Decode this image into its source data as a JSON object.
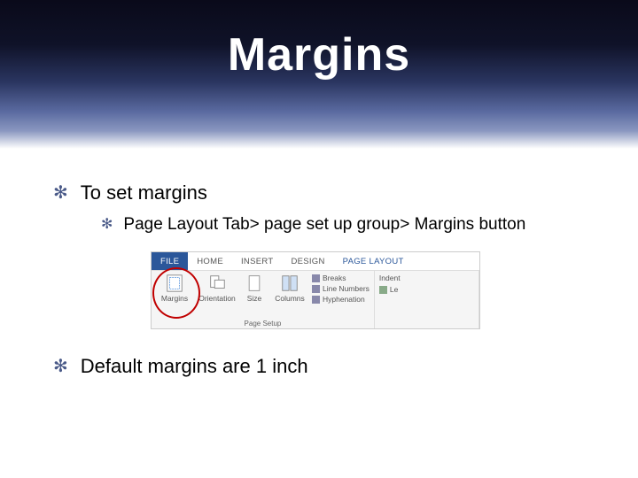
{
  "title": "Margins",
  "bullets": {
    "b1": "To set margins",
    "b1_1": "Page Layout Tab> page set up group> Margins button",
    "b2": "Default margins are 1 inch"
  },
  "ribbon": {
    "tabs": {
      "file": "FILE",
      "home": "HOME",
      "insert": "INSERT",
      "design": "DESIGN",
      "page_layout": "PAGE LAYOUT"
    },
    "page_setup": {
      "margins": "Margins",
      "orientation": "Orientation",
      "size": "Size",
      "columns": "Columns",
      "breaks": "Breaks",
      "line_numbers": "Line Numbers",
      "hyphenation": "Hyphenation",
      "group_label": "Page Setup"
    },
    "paragraph": {
      "indent": "Indent",
      "left": "Le"
    }
  }
}
